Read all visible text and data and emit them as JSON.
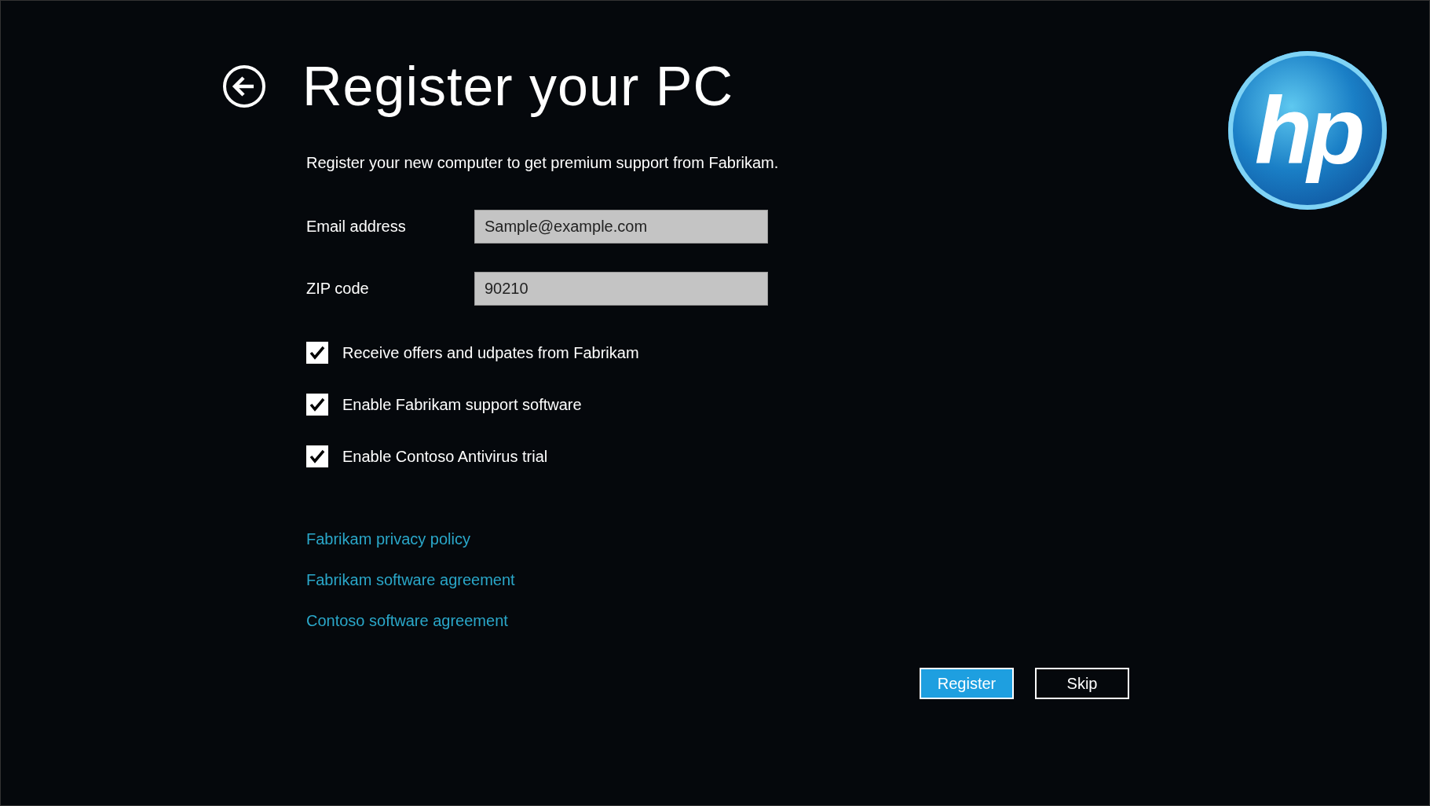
{
  "header": {
    "title": "Register your PC"
  },
  "logo": {
    "text": "hp"
  },
  "intro": "Register your new computer to get premium support from Fabrikam.",
  "fields": [
    {
      "label": "Email address",
      "value": "Sample@example.com"
    },
    {
      "label": "ZIP code",
      "value": "90210"
    }
  ],
  "options": [
    {
      "label": "Receive offers and udpates from Fabrikam",
      "checked": true
    },
    {
      "label": "Enable Fabrikam support software",
      "checked": true
    },
    {
      "label": "Enable Contoso Antivirus trial",
      "checked": true
    }
  ],
  "links": [
    "Fabrikam privacy policy",
    "Fabrikam software agreement",
    "Contoso software agreement"
  ],
  "buttons": [
    {
      "label": "Register",
      "kind": "primary"
    },
    {
      "label": "Skip",
      "kind": "secondary"
    }
  ]
}
